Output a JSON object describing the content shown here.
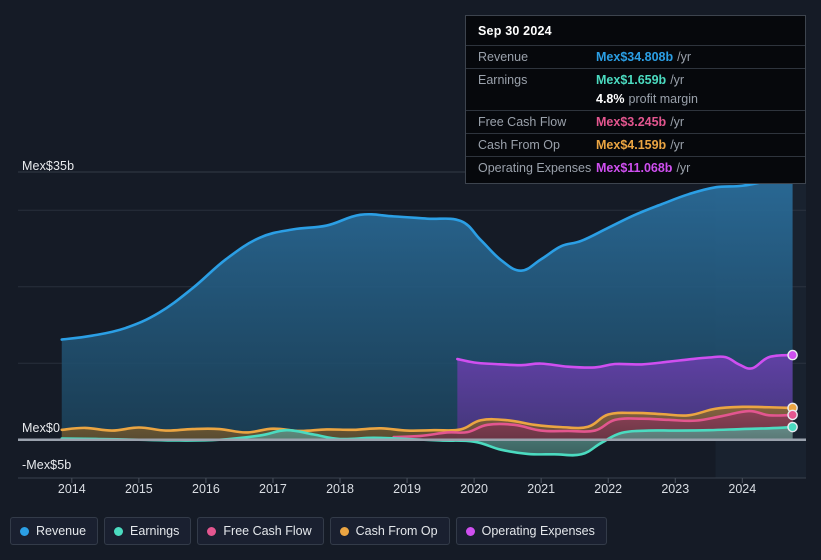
{
  "chart_data": {
    "type": "area",
    "title": "",
    "currency_prefix": "Mex$",
    "xlabel": "",
    "ylabel": "",
    "xlim": [
      2013.6,
      2024.95
    ],
    "ylim": [
      -5,
      35
    ],
    "grid": true,
    "zero_line": 0,
    "legend_position": "bottom-left",
    "x_tick_labels": [
      "2014",
      "2015",
      "2016",
      "2017",
      "2018",
      "2019",
      "2020",
      "2021",
      "2022",
      "2023",
      "2024"
    ],
    "x_ticks": [
      2014,
      2015,
      2016,
      2017,
      2018,
      2019,
      2020,
      2021,
      2022,
      2023,
      2024
    ],
    "y_tick_labels": [
      "Mex$35b",
      "Mex$0",
      "-Mex$5b"
    ],
    "y_ticks": [
      35,
      0,
      -5
    ],
    "y_gridlines": [
      35,
      30,
      20,
      10,
      0
    ],
    "forecast_start_x": 2023.6,
    "series": [
      {
        "name": "Revenue",
        "color": "#2b9fe5",
        "fill": "#1d4a6b",
        "x": [
          2013.85,
          2014.3,
          2014.8,
          2015.3,
          2015.8,
          2016.3,
          2016.8,
          2017.3,
          2017.8,
          2018.3,
          2018.8,
          2019.3,
          2019.8,
          2020.1,
          2020.4,
          2020.7,
          2021.0,
          2021.3,
          2021.6,
          2022.0,
          2022.4,
          2022.8,
          2023.2,
          2023.6,
          2024.0,
          2024.4,
          2024.75
        ],
        "values": [
          13.1,
          13.6,
          14.6,
          16.6,
          19.8,
          23.6,
          26.4,
          27.5,
          28.0,
          29.4,
          29.2,
          28.9,
          28.6,
          26.1,
          23.5,
          22.1,
          23.6,
          25.3,
          26.0,
          27.7,
          29.4,
          30.8,
          32.1,
          33.0,
          33.2,
          33.9,
          34.808
        ]
      },
      {
        "name": "Earnings",
        "color": "#4bdbc0",
        "fill": "#3d7a6e",
        "x": [
          2013.85,
          2014.4,
          2015.0,
          2015.6,
          2016.2,
          2016.8,
          2017.2,
          2017.6,
          2018.0,
          2018.5,
          2019.0,
          2019.5,
          2020.0,
          2020.4,
          2020.8,
          2021.2,
          2021.6,
          2021.9,
          2022.2,
          2022.6,
          2023.0,
          2023.5,
          2024.0,
          2024.4,
          2024.75
        ],
        "values": [
          0.15,
          0.1,
          0.0,
          -0.1,
          0.0,
          0.55,
          1.25,
          0.7,
          0.1,
          0.25,
          0.1,
          -0.1,
          -0.25,
          -1.3,
          -1.85,
          -1.9,
          -1.9,
          -0.4,
          0.9,
          1.2,
          1.2,
          1.25,
          1.4,
          1.5,
          1.659
        ]
      },
      {
        "name": "Free Cash Flow",
        "color": "#e3568f",
        "fill": "#7a2e4d",
        "x": [
          2018.8,
          2019.2,
          2019.6,
          2019.9,
          2020.2,
          2020.6,
          2021.0,
          2021.4,
          2021.8,
          2022.1,
          2022.5,
          2022.9,
          2023.3,
          2023.7,
          2024.1,
          2024.4,
          2024.75
        ],
        "values": [
          0.35,
          0.5,
          0.95,
          1.0,
          1.95,
          1.95,
          1.2,
          1.15,
          1.2,
          2.6,
          2.75,
          2.6,
          2.5,
          3.1,
          3.75,
          3.2,
          3.245
        ]
      },
      {
        "name": "Cash From Op",
        "color": "#eba542",
        "fill": "#7a5a28",
        "x": [
          2013.85,
          2014.2,
          2014.6,
          2015.0,
          2015.4,
          2015.8,
          2016.2,
          2016.6,
          2017.0,
          2017.4,
          2017.8,
          2018.2,
          2018.6,
          2019.0,
          2019.4,
          2019.8,
          2020.1,
          2020.5,
          2020.9,
          2021.3,
          2021.7,
          2022.0,
          2022.4,
          2022.8,
          2023.2,
          2023.6,
          2024.0,
          2024.4,
          2024.75
        ],
        "values": [
          1.3,
          1.55,
          1.2,
          1.6,
          1.2,
          1.4,
          1.4,
          0.95,
          1.45,
          1.15,
          1.35,
          1.3,
          1.5,
          1.2,
          1.25,
          1.35,
          2.55,
          2.55,
          1.95,
          1.65,
          1.7,
          3.3,
          3.5,
          3.35,
          3.2,
          4.05,
          4.3,
          4.25,
          4.159
        ]
      },
      {
        "name": "Operating Expenses",
        "color": "#cf4ff0",
        "fill": "#5b3b8f",
        "x": [
          2019.75,
          2020.0,
          2020.3,
          2020.7,
          2021.0,
          2021.4,
          2021.8,
          2022.1,
          2022.5,
          2022.9,
          2023.2,
          2023.5,
          2023.75,
          2023.95,
          2024.15,
          2024.4,
          2024.75
        ],
        "values": [
          10.55,
          10.1,
          9.9,
          9.75,
          9.95,
          9.55,
          9.45,
          9.9,
          9.85,
          10.2,
          10.5,
          10.75,
          10.8,
          9.85,
          9.35,
          10.8,
          11.068
        ]
      }
    ]
  },
  "tooltip": {
    "date": "Sep 30 2024",
    "rows": [
      {
        "label": "Revenue",
        "value": "Mex$34.808b",
        "unit": "/yr",
        "color": "#2b9fe5"
      },
      {
        "label": "Earnings",
        "value": "Mex$1.659b",
        "unit": "/yr",
        "color": "#4bdbc0"
      },
      {
        "label": "Free Cash Flow",
        "value": "Mex$3.245b",
        "unit": "/yr",
        "color": "#e3568f"
      },
      {
        "label": "Cash From Op",
        "value": "Mex$4.159b",
        "unit": "/yr",
        "color": "#eba542"
      },
      {
        "label": "Operating Expenses",
        "value": "Mex$11.068b",
        "unit": "/yr",
        "color": "#cf4ff0"
      }
    ],
    "profit_margin_value": "4.8%",
    "profit_margin_label": "profit margin"
  },
  "legend": {
    "items": [
      {
        "label": "Revenue",
        "color": "#2b9fe5"
      },
      {
        "label": "Earnings",
        "color": "#4bdbc0"
      },
      {
        "label": "Free Cash Flow",
        "color": "#e3568f"
      },
      {
        "label": "Cash From Op",
        "color": "#eba542"
      },
      {
        "label": "Operating Expenses",
        "color": "#cf4ff0"
      }
    ]
  },
  "axis": {
    "y_top_label": "Mex$35b",
    "y_zero_label": "Mex$0",
    "y_neg_label": "-Mex$5b"
  }
}
